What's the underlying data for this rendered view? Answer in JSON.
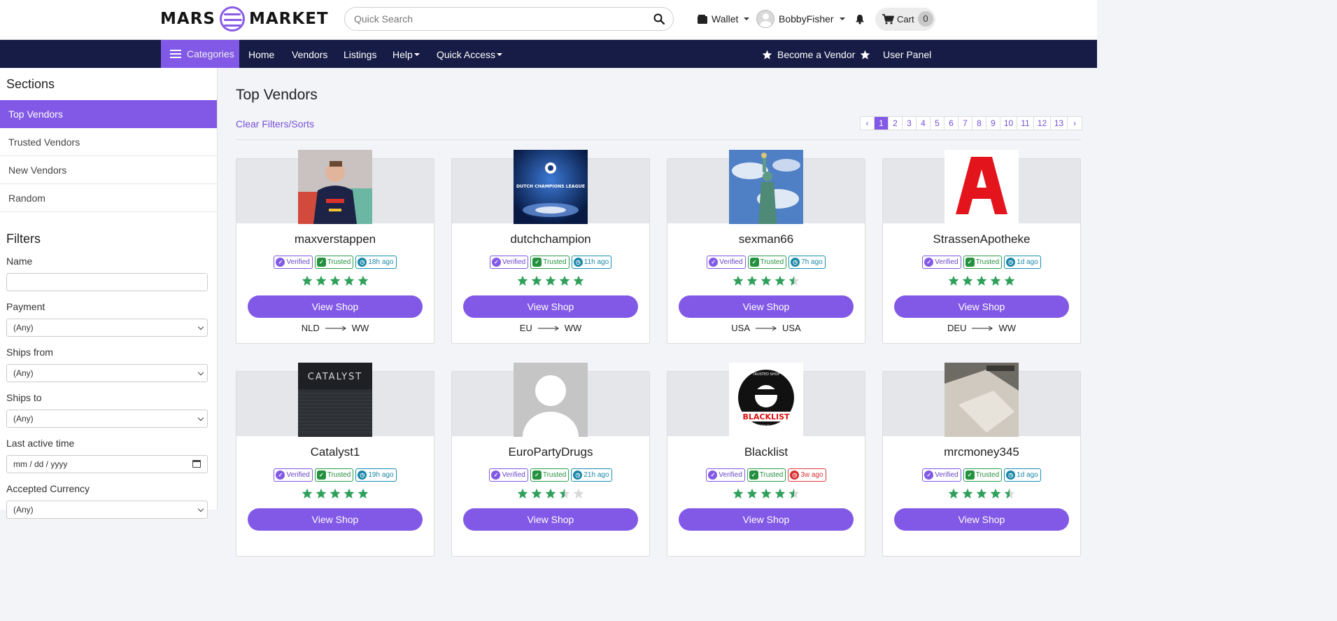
{
  "brand": {
    "left": "MARS",
    "right": "MARKET",
    "accent": "#8259e6",
    "navy": "#161c45"
  },
  "search": {
    "placeholder": "Quick Search",
    "value": ""
  },
  "header": {
    "wallet_label": "Wallet",
    "username": "BobbyFisher",
    "cart_label": "Cart",
    "cart_count": "0"
  },
  "nav": {
    "categories": "Categories",
    "links": [
      "Home",
      "Vendors",
      "Listings",
      "Help",
      "Quick Access"
    ],
    "become_vendor": "Become a Vendor",
    "user_panel": "User Panel"
  },
  "sidebar": {
    "sections_title": "Sections",
    "sections": [
      "Top Vendors",
      "Trusted Vendors",
      "New Vendors",
      "Random"
    ],
    "active_section": "Top Vendors",
    "filters_title": "Filters",
    "filters": {
      "name_label": "Name",
      "name_value": "",
      "payment_label": "Payment",
      "payment_value": "(Any)",
      "ships_from_label": "Ships from",
      "ships_from_value": "(Any)",
      "ships_to_label": "Ships to",
      "ships_to_value": "(Any)",
      "last_active_label": "Last active time",
      "last_active_placeholder": "mm / dd / yyyy",
      "currency_label": "Accepted Currency",
      "currency_value": "(Any)"
    }
  },
  "main": {
    "title": "Top Vendors",
    "clear_link": "Clear Filters/Sorts",
    "pagination": {
      "prev": "‹",
      "next": "›",
      "pages": [
        "1",
        "2",
        "3",
        "4",
        "5",
        "6",
        "7",
        "8",
        "9",
        "10",
        "11",
        "12",
        "13"
      ],
      "current": "1"
    },
    "verified_label": "Verified",
    "trusted_label": "Trusted",
    "view_shop_label": "View Shop",
    "vendors": [
      {
        "name": "maxverstappen",
        "last_active": "18h ago",
        "recent": true,
        "rating": 5,
        "from": "NLD",
        "to": "WW",
        "image": "racing-driver-photo"
      },
      {
        "name": "dutchchampion",
        "last_active": "11h ago",
        "recent": true,
        "rating": 5,
        "from": "EU",
        "to": "WW",
        "image": "champions-league-logo"
      },
      {
        "name": "sexman66",
        "last_active": "7h ago",
        "recent": true,
        "rating": 4.5,
        "from": "USA",
        "to": "USA",
        "image": "statue-of-liberty-photo"
      },
      {
        "name": "StrassenApotheke",
        "last_active": "1d ago",
        "recent": true,
        "rating": 5,
        "from": "DEU",
        "to": "WW",
        "image": "pharmacy-logo"
      },
      {
        "name": "Catalyst1",
        "last_active": "19h ago",
        "recent": true,
        "rating": 5,
        "from": "",
        "to": "",
        "image": "catalyst-logo"
      },
      {
        "name": "EuroPartyDrugs",
        "last_active": "21h ago",
        "recent": true,
        "rating": 3.5,
        "from": "",
        "to": "",
        "image": "default-avatar"
      },
      {
        "name": "Blacklist",
        "last_active": "3w ago",
        "recent": false,
        "rating": 4.5,
        "from": "",
        "to": "",
        "image": "blacklist-logo"
      },
      {
        "name": "mrcmoney345",
        "last_active": "1d ago",
        "recent": true,
        "rating": 4.5,
        "from": "",
        "to": "",
        "image": "product-photo"
      }
    ]
  }
}
